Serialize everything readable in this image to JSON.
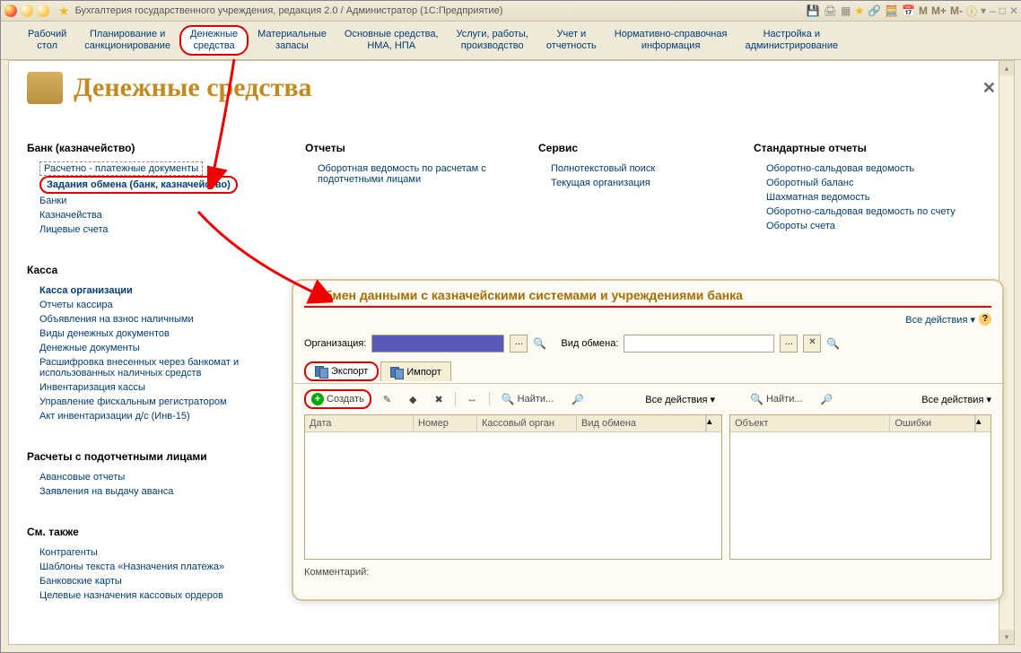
{
  "titlebar": {
    "title": "Бухгалтерия государственного учреждения, редакция 2.0 / Администратор  (1С:Предприятие)",
    "m1": "M",
    "m2": "M+",
    "m3": "M-"
  },
  "menu": {
    "items": [
      "Рабочий\nстол",
      "Планирование и\nсанкционирование",
      "Денежные\nсредства",
      "Материальные\nзапасы",
      "Основные средства,\nНМА, НПА",
      "Услуги, работы,\nпроизводство",
      "Учет и\nотчетность",
      "Нормативно-справочная\nинформация",
      "Настройка и\nадминистрирование"
    ]
  },
  "page": {
    "title": "Денежные средства"
  },
  "sections": {
    "bank": {
      "title": "Банк (казначейство)",
      "items": [
        "Расчетно - платежные документы",
        "Задания обмена (банк, казначейство)",
        "Банки",
        "Казначейства",
        "Лицевые счета"
      ]
    },
    "kassa": {
      "title": "Касса",
      "items": [
        "Касса организации",
        "Отчеты кассира",
        "Объявления на взнос наличными",
        "Виды денежных документов",
        "Денежные документы",
        "Расшифровка внесенных через банкомат и использованных наличных средств",
        "Инвентаризация кассы",
        "Управление фискальным регистратором",
        "Акт инвентаризации д/с (Инв-15)"
      ]
    },
    "raschety": {
      "title": "Расчеты с подотчетными лицами",
      "items": [
        "Авансовые отчеты",
        "Заявления на выдачу аванса"
      ]
    },
    "sm": {
      "title": "См. также",
      "items": [
        "Контрагенты",
        "Шаблоны текста «Назначения платежа»",
        "Банковские карты",
        "Целевые назначения кассовых ордеров"
      ]
    },
    "reports": {
      "title": "Отчеты",
      "items": [
        "Оборотная ведомость по расчетам с подотчетными лицами"
      ]
    },
    "service": {
      "title": "Сервис",
      "items": [
        "Полнотекстовый поиск",
        "Текущая организация"
      ]
    },
    "std": {
      "title": "Стандартные отчеты",
      "items": [
        "Оборотно-сальдовая ведомость",
        "Оборотный баланс",
        "Шахматная ведомость",
        "Оборотно-сальдовая ведомость по счету",
        "Обороты счета"
      ]
    }
  },
  "panel": {
    "title": "Обмен данными с казначейскими системами и учреждениями банка",
    "all_actions": "Все действия",
    "org_label": "Организация:",
    "type_label": "Вид обмена:",
    "tab_export": "Экспорт",
    "tab_import": "Импорт",
    "create": "Создать",
    "find": "Найти...",
    "grid1_cols": [
      "Дата",
      "Номер",
      "Кассовый орган",
      "Вид обмена"
    ],
    "grid2_cols": [
      "Объект",
      "Ошибки"
    ],
    "comment": "Комментарий:"
  }
}
